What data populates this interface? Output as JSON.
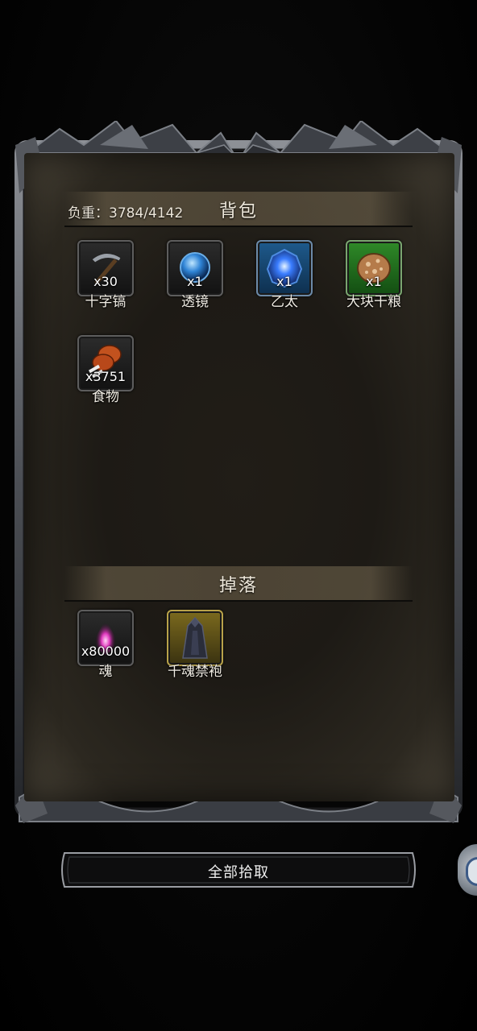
{
  "bag": {
    "title": "背包",
    "weight": "负重：3784/4142",
    "items": [
      {
        "name": "十字镐",
        "qty": "x30",
        "icon": "pickaxe-icon"
      },
      {
        "name": "透镜",
        "qty": "x1",
        "icon": "lens-orb-icon"
      },
      {
        "name": "乙太",
        "qty": "x1",
        "icon": "ether-crystal-icon"
      },
      {
        "name": "大块干粮",
        "qty": "x1",
        "icon": "dry-ration-icon"
      },
      {
        "name": "食物",
        "qty": "x3751",
        "icon": "meat-drumstick-icon"
      }
    ]
  },
  "drop": {
    "title": "掉落",
    "items": [
      {
        "name": "魂",
        "qty": "x80000",
        "icon": "soul-flame-icon"
      },
      {
        "name": "千魂禁袍",
        "qty": "",
        "icon": "dark-robe-icon"
      }
    ]
  },
  "actions": {
    "pickup_all": "全部拾取"
  },
  "colors": {
    "rare_blue": "#1e5a8c",
    "uncommon_green": "#2f8a28",
    "legendary_gold": "#7b6a1e"
  }
}
